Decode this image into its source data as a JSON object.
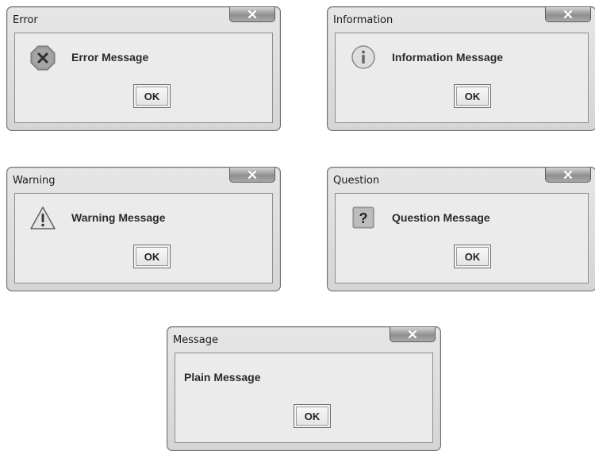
{
  "dialogs": {
    "error": {
      "title": "Error",
      "message": "Error Message",
      "ok_label": "OK",
      "close_glyph": "x",
      "icon": "error-icon",
      "icon_glyph": "x"
    },
    "information": {
      "title": "Information",
      "message": "Information Message",
      "ok_label": "OK",
      "close_glyph": "x",
      "icon": "information-icon",
      "icon_glyph": "i"
    },
    "warning": {
      "title": "Warning",
      "message": "Warning Message",
      "ok_label": "OK",
      "close_glyph": "x",
      "icon": "warning-icon",
      "icon_glyph": "!"
    },
    "question": {
      "title": "Question",
      "message": "Question Message",
      "ok_label": "OK",
      "close_glyph": "x",
      "icon": "question-icon",
      "icon_glyph": "?"
    },
    "plain": {
      "title": "Message",
      "message": "Plain Message",
      "ok_label": "OK",
      "close_glyph": "x"
    }
  },
  "colors": {
    "window_frame": "#6f6f6f",
    "client_bg": "#ebebeb",
    "text": "#2a2a2a"
  }
}
